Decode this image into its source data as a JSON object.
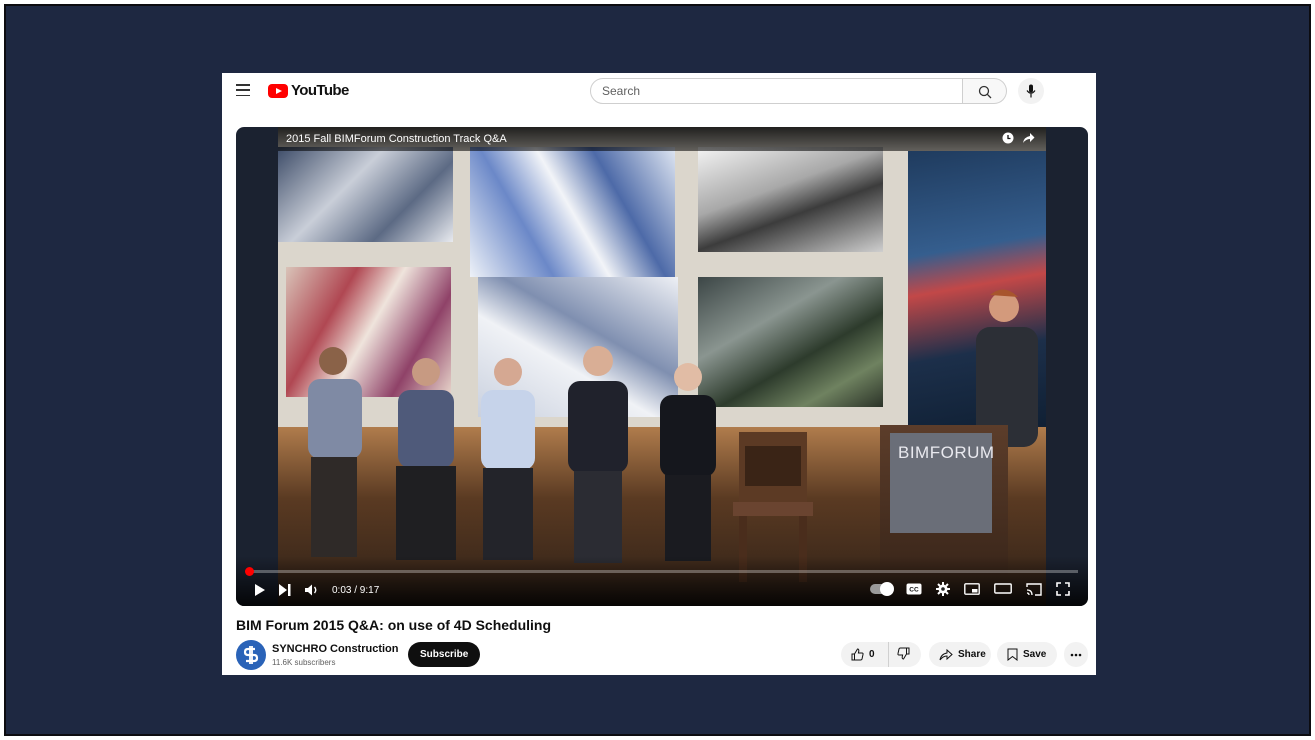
{
  "header": {
    "logo_text": "YouTube",
    "search_placeholder": "Search"
  },
  "player": {
    "video_title": "2015 Fall BIMForum Construction Track Q&A",
    "current_time": "0:03",
    "duration": "9:17",
    "time_display": "0:03 / 9:17",
    "progress_fraction": 0.005,
    "podium_text": "BIMFORUM"
  },
  "video": {
    "title": "BIM Forum 2015 Q&A: on use of 4D Scheduling",
    "channel_name": "SYNCHRO Construction",
    "subscribers": "11.6K subscribers",
    "subscribe_label": "Subscribe",
    "like_count": "0",
    "share_label": "Share",
    "save_label": "Save"
  },
  "colors": {
    "background": "#1e2841",
    "brand": "#ff0000",
    "subscribe_bg": "#0f0f0f"
  }
}
